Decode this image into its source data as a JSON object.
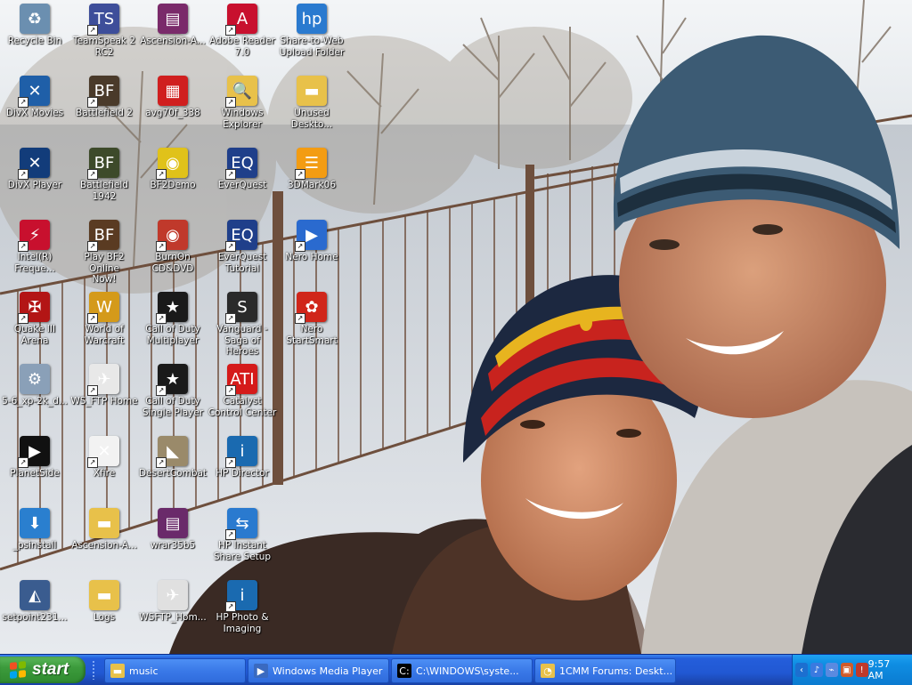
{
  "desktop": {
    "icons": [
      {
        "label": "Recycle Bin",
        "icon": "recycle-bin-icon",
        "color": "#6b8fb0",
        "glyph": "♻",
        "shortcut": false
      },
      {
        "label": "DivX Movies",
        "icon": "divx-movies-icon",
        "color": "#1f5fa8",
        "glyph": "✕",
        "shortcut": true
      },
      {
        "label": "DivX Player",
        "icon": "divx-player-icon",
        "color": "#123c7a",
        "glyph": "✕",
        "shortcut": true
      },
      {
        "label": "Intel(R)\nFreque...",
        "icon": "intel-frequency-icon",
        "color": "#c8102e",
        "glyph": "⚡",
        "shortcut": true
      },
      {
        "label": "Quake III\nArena",
        "icon": "quake-iii-icon",
        "color": "#b31515",
        "glyph": "✠",
        "shortcut": true
      },
      {
        "label": "5-6_xp-2k_d...",
        "icon": "driver-installer-icon",
        "color": "#8aa0b8",
        "glyph": "⚙",
        "shortcut": false
      },
      {
        "label": "PlanetSide",
        "icon": "planetside-icon",
        "color": "#111111",
        "glyph": "▶",
        "shortcut": true
      },
      {
        "label": "_psinstall",
        "icon": "psinstall-icon",
        "color": "#2a7fcf",
        "glyph": "⬇",
        "shortcut": false
      },
      {
        "label": "setpoint231...",
        "icon": "setpoint-icon",
        "color": "#3a5c8f",
        "glyph": "◭",
        "shortcut": false
      },
      {
        "label": "TeamSpeak 2\nRC2",
        "icon": "teamspeak-icon",
        "color": "#3e4e9a",
        "glyph": "TS",
        "shortcut": true
      },
      {
        "label": "Battlefield 2",
        "icon": "battlefield-2-icon",
        "color": "#4a3a2a",
        "glyph": "BF",
        "shortcut": true
      },
      {
        "label": "Battlefield\n1942",
        "icon": "battlefield-1942-icon",
        "color": "#3d4a2a",
        "glyph": "BF",
        "shortcut": true
      },
      {
        "label": "Play BF2 Online\nNow!",
        "icon": "play-bf2-online-icon",
        "color": "#5a3b22",
        "glyph": "BF",
        "shortcut": true
      },
      {
        "label": "World of\nWarcraft",
        "icon": "world-of-warcraft-icon",
        "color": "#d49a1a",
        "glyph": "W",
        "shortcut": true
      },
      {
        "label": "WS_FTP Home",
        "icon": "ws-ftp-home-icon",
        "color": "#e8e8e8",
        "glyph": "✈",
        "shortcut": true
      },
      {
        "label": "Xfire",
        "icon": "xfire-icon",
        "color": "#f2f2f2",
        "glyph": "✕",
        "shortcut": true
      },
      {
        "label": "Ascension-A...",
        "icon": "folder-icon",
        "color": "#e8c14a",
        "glyph": "▬",
        "shortcut": false
      },
      {
        "label": "Logs",
        "icon": "folder-icon",
        "color": "#e8c14a",
        "glyph": "▬",
        "shortcut": false
      },
      {
        "label": "Ascension-A...",
        "icon": "winrar-archive-icon",
        "color": "#7a2a6a",
        "glyph": "▤",
        "shortcut": false
      },
      {
        "label": "avg70f_338",
        "icon": "avg-icon",
        "color": "#d01f1f",
        "glyph": "▦",
        "shortcut": false
      },
      {
        "label": "BF2Demo",
        "icon": "bf2demo-cd-icon",
        "color": "#e0c21a",
        "glyph": "◉",
        "shortcut": true
      },
      {
        "label": "BurnOn\nCD&DVD",
        "icon": "burnon-icon",
        "color": "#c0392b",
        "glyph": "◉",
        "shortcut": true
      },
      {
        "label": "Call of Duty\nMultiplayer",
        "icon": "call-of-duty-mp-icon",
        "color": "#1a1a1a",
        "glyph": "★",
        "shortcut": true
      },
      {
        "label": "Call of Duty\nSingle Player",
        "icon": "call-of-duty-sp-icon",
        "color": "#1a1a1a",
        "glyph": "★",
        "shortcut": true
      },
      {
        "label": "DesertCombat",
        "icon": "desertcombat-icon",
        "color": "#9a8a6a",
        "glyph": "◣",
        "shortcut": true
      },
      {
        "label": "wrar35b5",
        "icon": "winrar-installer-icon",
        "color": "#6a2a6a",
        "glyph": "▤",
        "shortcut": false
      },
      {
        "label": "WSFTP_Hom...",
        "icon": "wsftp-installer-icon",
        "color": "#e0e0e0",
        "glyph": "✈",
        "shortcut": false
      },
      {
        "label": "Adobe Reader\n7.0",
        "icon": "adobe-reader-icon",
        "color": "#c8102e",
        "glyph": "A",
        "shortcut": true
      },
      {
        "label": "Windows\nExplorer",
        "icon": "windows-explorer-icon",
        "color": "#e8c14a",
        "glyph": "🔍",
        "shortcut": true
      },
      {
        "label": "EverQuest",
        "icon": "everquest-icon",
        "color": "#1f3f8a",
        "glyph": "EQ",
        "shortcut": true
      },
      {
        "label": "EverQuest\nTutorial",
        "icon": "everquest-tutorial-icon",
        "color": "#1f3f8a",
        "glyph": "EQ",
        "shortcut": true
      },
      {
        "label": "Vanguard -\nSaga of Heroes",
        "icon": "vanguard-icon",
        "color": "#2a2a2a",
        "glyph": "S",
        "shortcut": true
      },
      {
        "label": "Catalyst\nControl Center",
        "icon": "ati-catalyst-icon",
        "color": "#d51a1a",
        "glyph": "ATI",
        "shortcut": true
      },
      {
        "label": "HP Director",
        "icon": "hp-director-icon",
        "color": "#1a6ab0",
        "glyph": "i",
        "shortcut": true
      },
      {
        "label": "HP Instant\nShare Setup",
        "icon": "hp-instant-share-icon",
        "color": "#2a7acf",
        "glyph": "⇆",
        "shortcut": true
      },
      {
        "label": "HP Photo &\nImaging",
        "icon": "hp-photo-imaging-icon",
        "color": "#1a6ab0",
        "glyph": "i",
        "shortcut": true
      },
      {
        "label": "Share-to-Web\nUpload Folder",
        "icon": "share-to-web-icon",
        "color": "#2a7acf",
        "glyph": "hp",
        "shortcut": false
      },
      {
        "label": "Unused\nDeskto...",
        "icon": "folder-icon",
        "color": "#e8c14a",
        "glyph": "▬",
        "shortcut": false
      },
      {
        "label": "3DMark06",
        "icon": "3dmark06-icon",
        "color": "#f39c12",
        "glyph": "☰",
        "shortcut": true
      },
      {
        "label": "Nero Home",
        "icon": "nero-home-icon",
        "color": "#2a6acf",
        "glyph": "▶",
        "shortcut": true
      },
      {
        "label": "Nero\nStartSmart",
        "icon": "nero-startsmart-icon",
        "color": "#d0261a",
        "glyph": "✿",
        "shortcut": true
      }
    ]
  },
  "taskbar": {
    "start_label": "start",
    "tasks": [
      {
        "label": "music",
        "icon": "folder-icon",
        "color": "#e8c14a",
        "glyph": "▬"
      },
      {
        "label": "Windows Media Player",
        "icon": "windows-media-player-icon",
        "color": "#3a6ac0",
        "glyph": "▶"
      },
      {
        "label": "C:\\WINDOWS\\syste...",
        "icon": "command-prompt-icon",
        "color": "#000000",
        "glyph": "C:"
      },
      {
        "label": "1CMM Forums: Deskt...",
        "icon": "browser-window-icon",
        "color": "#e8c14a",
        "glyph": "◔"
      }
    ],
    "tray": {
      "clock": "9:57 AM",
      "icons": [
        {
          "icon": "show-hidden-icons-chevron-icon",
          "color": "#1c6fd0",
          "glyph": "‹"
        },
        {
          "icon": "volume-icon",
          "color": "#3a7ae0",
          "glyph": "♪"
        },
        {
          "icon": "network-icon",
          "color": "#5a8ae0",
          "glyph": "⌁"
        },
        {
          "icon": "display-settings-icon",
          "color": "#d05a2a",
          "glyph": "▣"
        },
        {
          "icon": "security-alert-icon",
          "color": "#c0392b",
          "glyph": "!"
        }
      ]
    }
  }
}
